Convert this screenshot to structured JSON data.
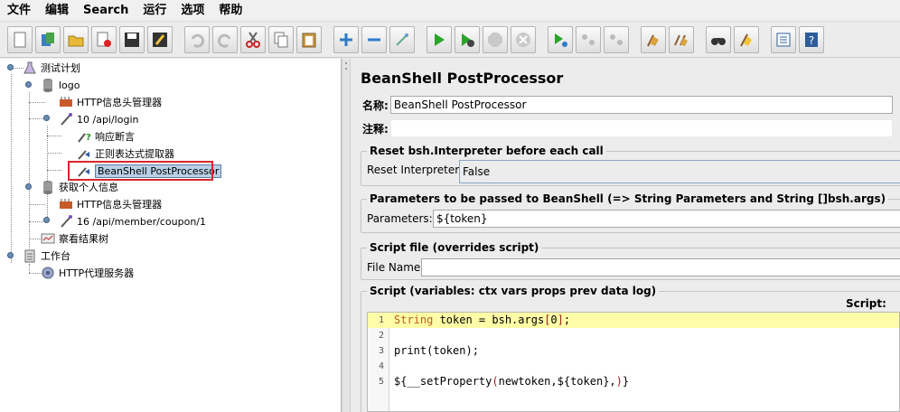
{
  "menu": [
    "文件",
    "编辑",
    "Search",
    "运行",
    "选项",
    "帮助"
  ],
  "tree": {
    "test_plan": "测试计划",
    "group1": "logo",
    "http_header_1": "HTTP信息头管理器",
    "sampler_login": "10 /api/login",
    "assertion": "响应断言",
    "regex_extractor": "正则表达式提取器",
    "beanshell": "BeanShell PostProcessor",
    "group2": "获取个人信息",
    "http_header_2": "HTTP信息头管理器",
    "sampler_coupon": "16 /api/member/coupon/1",
    "result_tree": "察看结果树",
    "workbench": "工作台",
    "proxy": "HTTP代理服务器"
  },
  "panel": {
    "title": "BeanShell PostProcessor",
    "name_label": "名称:",
    "name_value": "BeanShell PostProcessor",
    "comment_label": "注释:",
    "comment_value": "",
    "reset_group_title": "Reset bsh.Interpreter before each call",
    "reset_label": "Reset Interpreter:",
    "reset_value": "False",
    "params_group_title": "Parameters to be passed to BeanShell (=> String Parameters and String []bsh.args)",
    "params_label": "Parameters:",
    "params_value": "${token}",
    "file_group_title": "Script file (overrides script)",
    "file_label": "File Name:",
    "file_value": "",
    "script_group_title": "Script (variables: ctx vars props prev data log)",
    "script_label": "Script:"
  },
  "script_lines": [
    {
      "num": "1",
      "text": "String token = bsh.args[0];"
    },
    {
      "num": "2",
      "text": ""
    },
    {
      "num": "3",
      "text": "print(token);"
    },
    {
      "num": "4",
      "text": ""
    },
    {
      "num": "5",
      "text": "${__setProperty(newtoken,${token},)}"
    }
  ],
  "colors": {
    "selection_outline": "#d9262c",
    "current_line": "#fffca8",
    "keyword": "#b8621a"
  }
}
